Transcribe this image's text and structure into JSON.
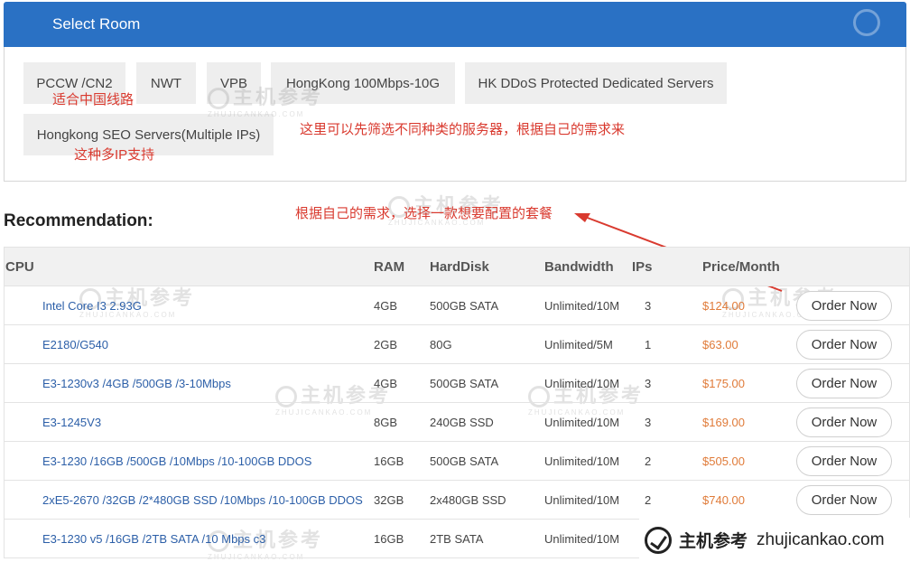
{
  "header": {
    "title": "Select Room"
  },
  "rooms": [
    {
      "label": "PCCW /CN2"
    },
    {
      "label": "NWT"
    },
    {
      "label": "VPB"
    },
    {
      "label": "HongKong 100Mbps-10G"
    },
    {
      "label": "HK DDoS Protected Dedicated Servers"
    },
    {
      "label": "Hongkong SEO Servers(Multiple IPs)"
    }
  ],
  "annotations": {
    "china_line": "适合中国线路",
    "multi_ip": "这种多IP支持",
    "filter_hint": "这里可以先筛选不同种类的服务器，根据自己的需求来",
    "choose_hint": "根据自己的需求，选择一款想要配置的套餐"
  },
  "recommendation": {
    "title": "Recommendation:"
  },
  "table": {
    "headers": {
      "cpu": "CPU",
      "ram": "RAM",
      "disk": "HardDisk",
      "bw": "Bandwidth",
      "ips": "IPs",
      "price": "Price/Month"
    },
    "order_label": "Order Now",
    "rows": [
      {
        "cpu": "Intel Core I3 2.93G",
        "ram": "4GB",
        "disk": "500GB SATA",
        "bw": "Unlimited/10M",
        "ips": "3",
        "price": "$124.00"
      },
      {
        "cpu": "E2180/G540",
        "ram": "2GB",
        "disk": "80G",
        "bw": "Unlimited/5M",
        "ips": "1",
        "price": "$63.00"
      },
      {
        "cpu": "E3-1230v3 /4GB /500GB /3-10Mbps",
        "ram": "4GB",
        "disk": "500GB SATA",
        "bw": "Unlimited/10M",
        "ips": "3",
        "price": "$175.00"
      },
      {
        "cpu": "E3-1245V3",
        "ram": "8GB",
        "disk": "240GB SSD",
        "bw": "Unlimited/10M",
        "ips": "3",
        "price": "$169.00"
      },
      {
        "cpu": "E3-1230 /16GB /500GB /10Mbps /10-100GB DDOS",
        "ram": "16GB",
        "disk": "500GB SATA",
        "bw": "Unlimited/10M",
        "ips": "2",
        "price": "$505.00"
      },
      {
        "cpu": "2xE5-2670 /32GB /2*480GB SSD /10Mbps /10-100GB DDOS",
        "ram": "32GB",
        "disk": "2x480GB SSD",
        "bw": "Unlimited/10M",
        "ips": "2",
        "price": "$740.00"
      },
      {
        "cpu": "E3-1230 v5 /16GB /2TB SATA /10 Mbps c3",
        "ram": "16GB",
        "disk": "2TB SATA",
        "bw": "Unlimited/10M",
        "ips": "",
        "price": ""
      }
    ]
  },
  "watermark": {
    "cn": "主机参考",
    "en": "ZHUJICANKAO.COM"
  },
  "brand": {
    "name": "主机参考",
    "domain": "zhujicankao.com"
  },
  "colors": {
    "header": "#2a71c4",
    "price": "#e07b39",
    "link": "#2c5fa8",
    "annotation": "#d93a2f"
  }
}
